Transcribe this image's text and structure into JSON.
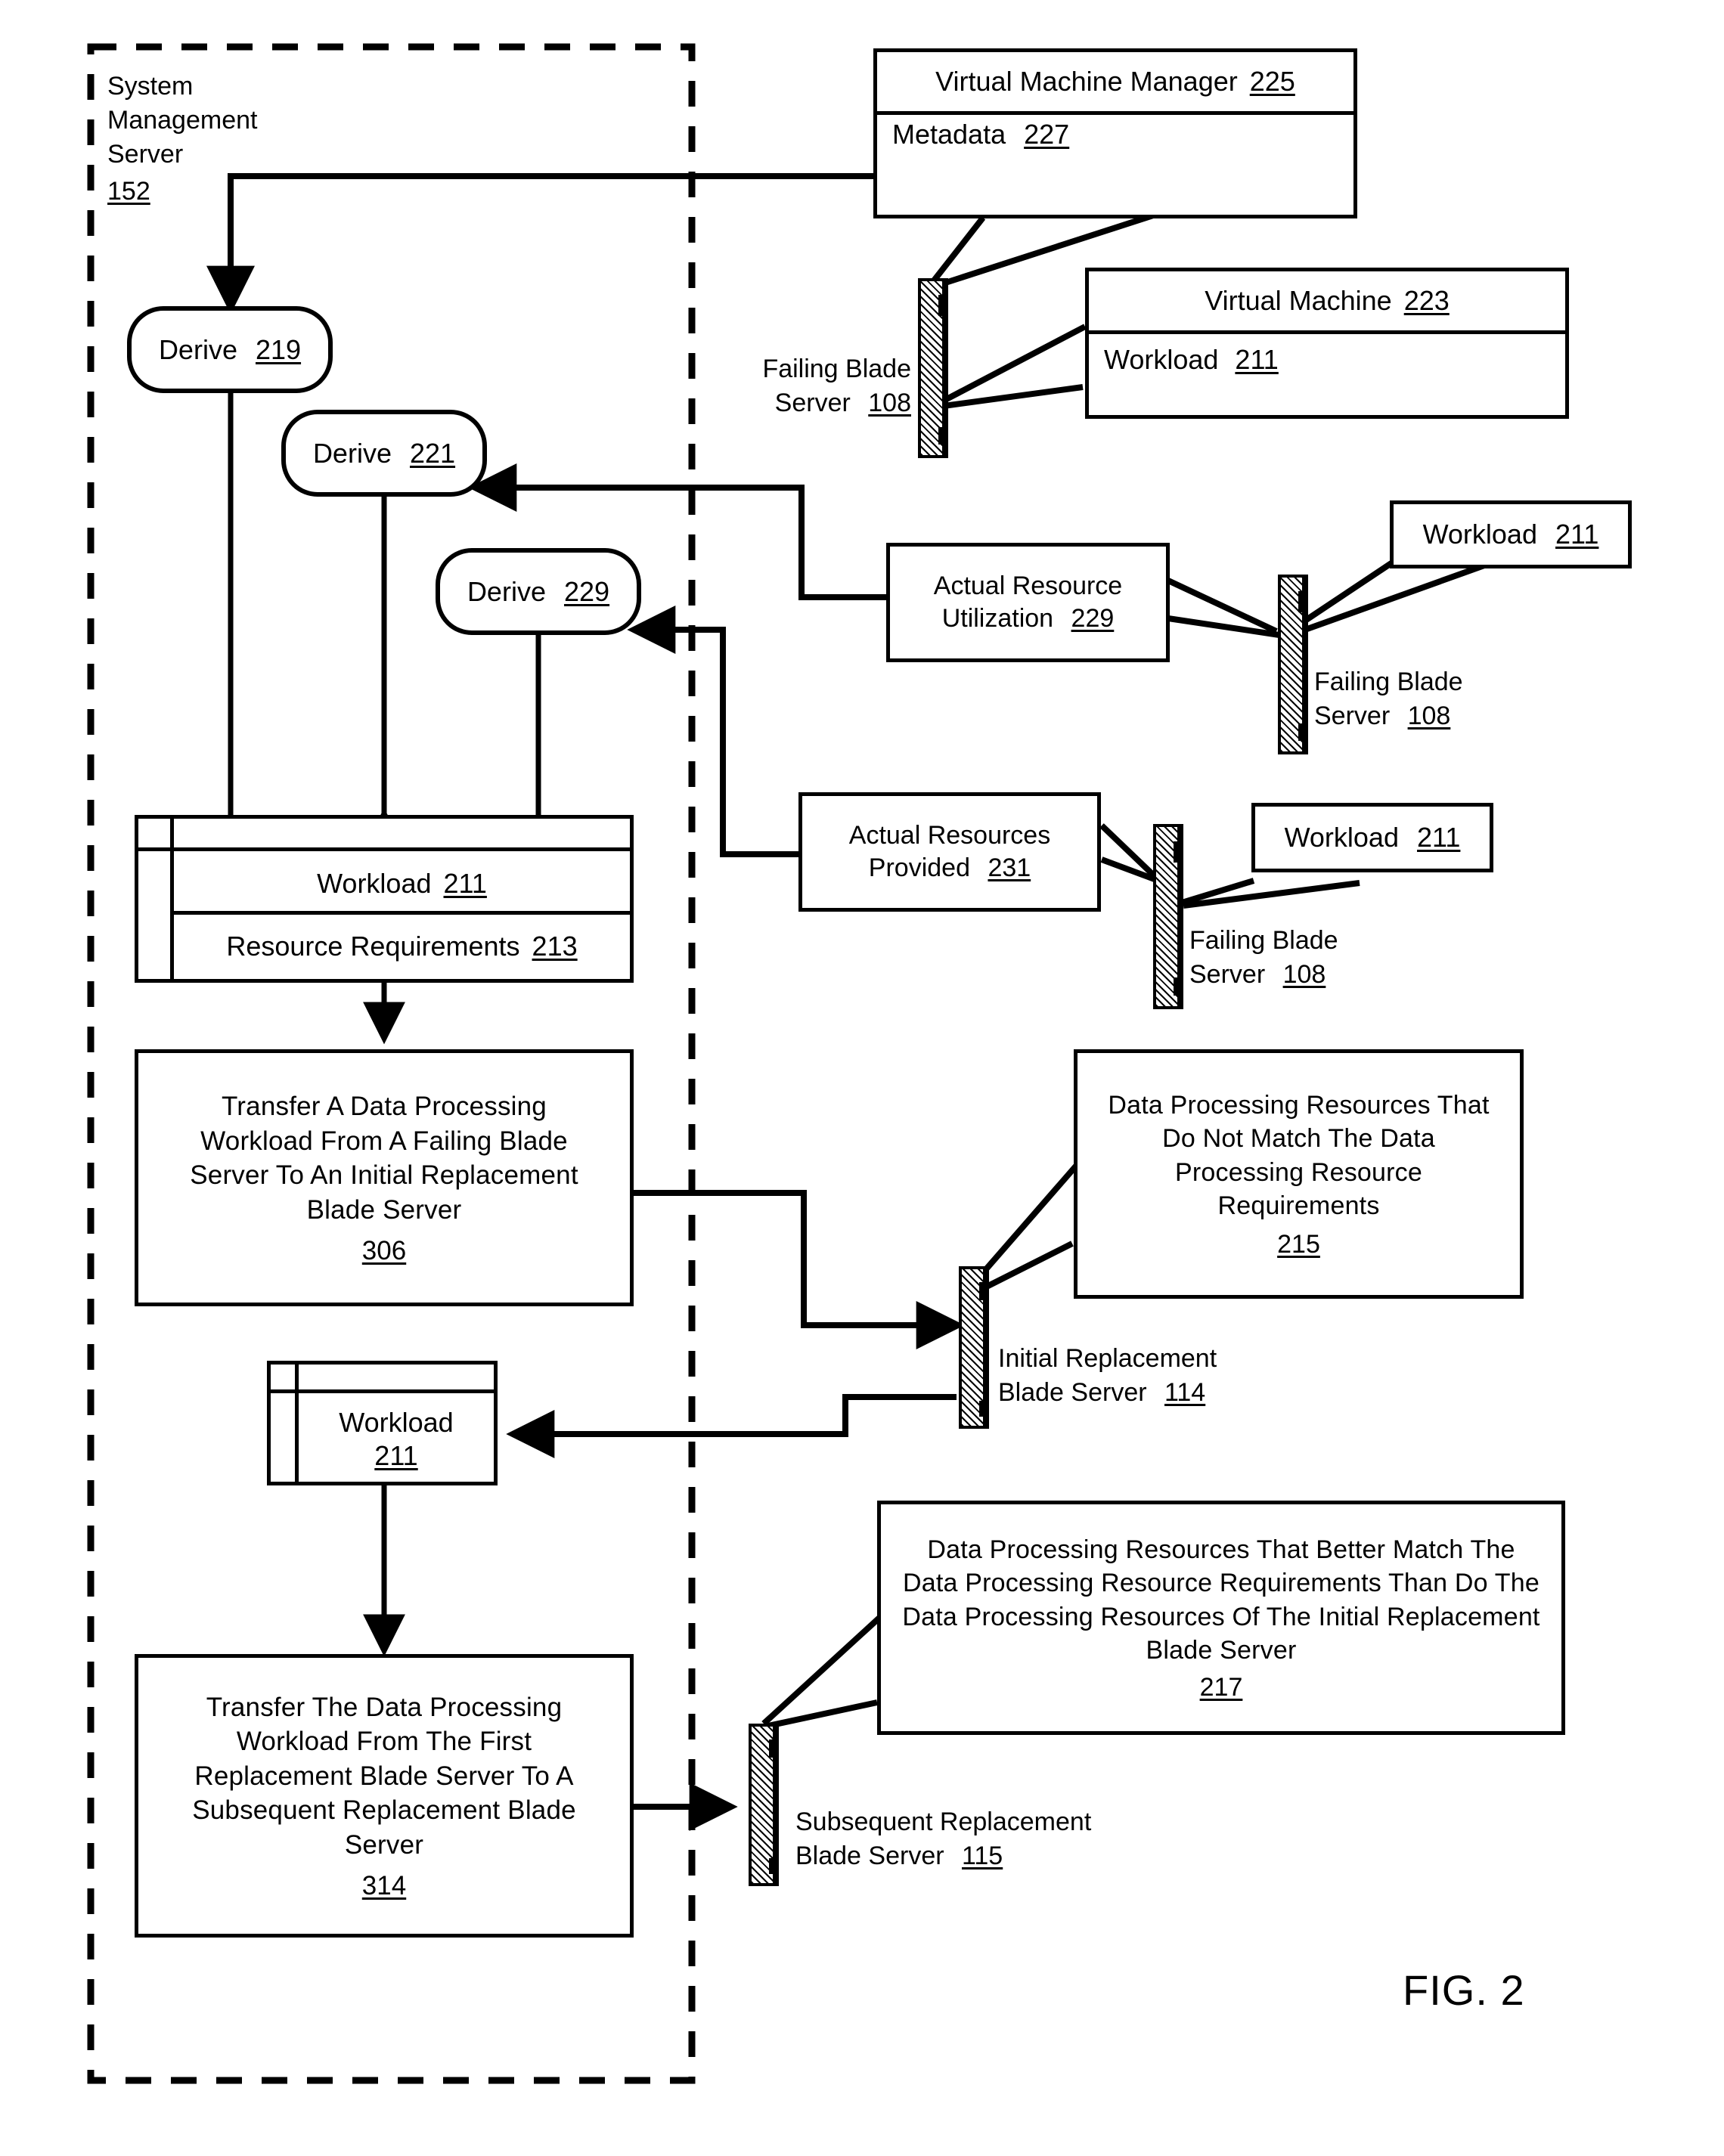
{
  "figure": {
    "label": "FIG. 2",
    "boundary_name": "System Management Server"
  },
  "system_management_server": {
    "line1": "System",
    "line2": "Management",
    "line3": "Server",
    "ref": "152"
  },
  "processes": [
    {
      "label": "Derive",
      "ref": "219"
    },
    {
      "label": "Derive",
      "ref": "221"
    },
    {
      "label": "Derive",
      "ref": "229"
    }
  ],
  "vm_manager": {
    "title": "Virtual Machine Manager",
    "title_ref": "225",
    "metadata": "Metadata",
    "metadata_ref": "227"
  },
  "virtual_machine": {
    "title": "Virtual Machine",
    "title_ref": "223",
    "workload": "Workload",
    "workload_ref": "211"
  },
  "blade_servers": [
    {
      "line1": "Failing Blade",
      "line2": "Server",
      "ref": "108",
      "position": "top"
    },
    {
      "line1": "Failing Blade",
      "line2": "Server",
      "ref": "108",
      "position": "middle"
    },
    {
      "line1": "Failing Blade",
      "line2": "Server",
      "ref": "108",
      "position": "lower"
    },
    {
      "line1": "Initial Replacement",
      "line2": "Blade Server",
      "ref": "114",
      "position": "initial-replacement"
    },
    {
      "line1": "Subsequent Replacement",
      "line2": "Blade Server",
      "ref": "115",
      "position": "subsequent-replacement"
    }
  ],
  "callouts": {
    "workload_top": {
      "label": "Workload",
      "ref": "211"
    },
    "workload_mid": {
      "label": "Workload",
      "ref": "211"
    },
    "actual_resource_utilization": {
      "line1": "Actual Resource",
      "line2": "Utilization",
      "ref": "229"
    },
    "actual_resources_provided": {
      "line1": "Actual Resources",
      "line2": "Provided",
      "ref": "231"
    },
    "resources_not_match": {
      "text": "Data Processing Resources That Do Not Match The Data Processing Resource Requirements",
      "ref": "215"
    },
    "resources_better_match": {
      "text": "Data Processing Resources That Better Match The Data Processing Resource Requirements Than Do The Data Processing Resources Of The Initial Replacement Blade Server",
      "ref": "217"
    }
  },
  "workload_requirements_card": {
    "workload": "Workload",
    "workload_ref": "211",
    "requirements": "Resource Requirements",
    "requirements_ref": "213"
  },
  "workload_card_lower": {
    "workload": "Workload",
    "workload_ref": "211"
  },
  "steps": [
    {
      "text": "Transfer A Data Processing Workload From A Failing Blade Server To An Initial Replacement Blade Server",
      "ref": "306"
    },
    {
      "text": "Transfer The Data Processing Workload From The First Replacement Blade Server To A Subsequent Replacement Blade Server",
      "ref": "314"
    }
  ],
  "colors": {
    "ink": "#000000",
    "paper": "#ffffff"
  }
}
